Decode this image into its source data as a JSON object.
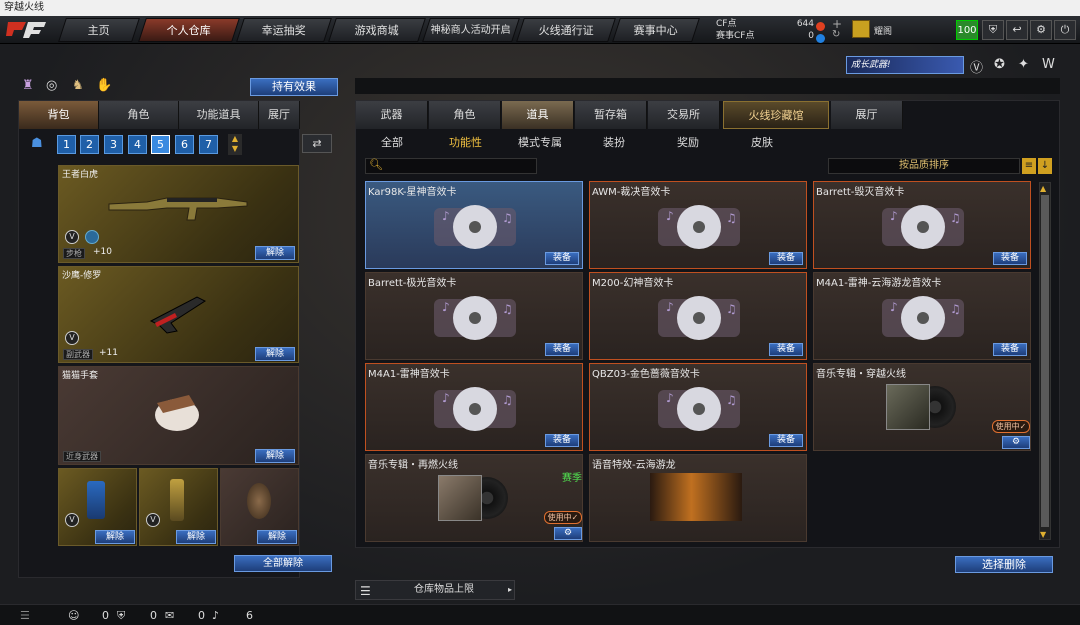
{
  "window": {
    "title": "穿越火线"
  },
  "nav": {
    "tabs": [
      {
        "label": "主页"
      },
      {
        "label": "个人仓库"
      },
      {
        "label": "幸运抽奖"
      },
      {
        "label": "游戏商城"
      },
      {
        "label": "神秘商人活动开启"
      },
      {
        "label": "火线通行证"
      },
      {
        "label": "赛事中心"
      }
    ],
    "cf_label": "CF点",
    "match_cf_label": "赛事CF点",
    "cf_value": "644",
    "match_cf_value": "0",
    "username": "耀阁",
    "level": "100"
  },
  "left": {
    "effects_button": "持有效果",
    "tabs": [
      "背包",
      "角色",
      "功能道具",
      "展厅"
    ],
    "pages": [
      "1",
      "2",
      "3",
      "4",
      "5",
      "6",
      "7"
    ],
    "cards": [
      {
        "title": "王者白虎",
        "type": "步枪",
        "plus": "+10",
        "action": "解除"
      },
      {
        "title": "沙鹰-修罗",
        "type": "副武器",
        "plus": "+11",
        "action": "解除"
      },
      {
        "title": "猫猫手套",
        "type": "近身武器",
        "action": "解除"
      }
    ],
    "small_cards": [
      {
        "action": "解除"
      },
      {
        "action": "解除"
      },
      {
        "action": "解除"
      }
    ],
    "unequip_all": "全部解除"
  },
  "banner": {
    "text": "成长武器!"
  },
  "right": {
    "tabs": [
      "武器",
      "角色",
      "道具",
      "暂存箱",
      "交易所",
      "火线珍藏馆",
      "展厅"
    ],
    "subtabs": [
      "全部",
      "功能性",
      "模式专属",
      "装扮",
      "奖励",
      "皮肤"
    ],
    "sort": "按品质排序",
    "items": [
      {
        "title": "Kar98K-星神音效卡",
        "action": "装备"
      },
      {
        "title": "AWM-裁决音效卡",
        "action": "装备"
      },
      {
        "title": "Barrett-毁灭音效卡",
        "action": "装备"
      },
      {
        "title": "Barrett-极光音效卡",
        "action": "装备"
      },
      {
        "title": "M200-幻神音效卡",
        "action": "装备"
      },
      {
        "title": "M4A1-雷神-云海游龙音效卡",
        "action": "装备"
      },
      {
        "title": "M4A1-雷神音效卡",
        "action": "装备"
      },
      {
        "title": "QBZ03-金色蔷薇音效卡",
        "action": "装备"
      },
      {
        "title": "音乐专辑・穿越火线",
        "inuse": "使用中✓"
      },
      {
        "title": "音乐专辑・再燃火线",
        "inuse": "使用中✓",
        "tag": "赛季"
      },
      {
        "title": "语音特效-云海游龙"
      }
    ],
    "delete_button": "选择删除",
    "warehouse_limit": "仓库物品上限"
  },
  "bottom": {
    "stats": [
      "0",
      "0",
      "0",
      "6"
    ]
  },
  "colors": {
    "accent_blue": "#1e3e7a",
    "gold": "#c9a020",
    "selected_border": "#c05020"
  }
}
